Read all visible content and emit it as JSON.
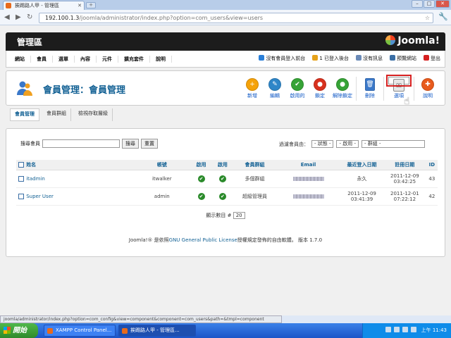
{
  "browser": {
    "tab_title": "挨踢路人甲 - 管理區",
    "new_tab": "+",
    "url_host": "192.100.1.3",
    "url_path": "/joomla/administrator/index.php?option=com_users&view=users",
    "status_url": "joomla/administrator/index.php?option=com_config&view=component&component=com_users&path=&tmpl=component"
  },
  "header": {
    "title": "管理區",
    "logo": "Joomla!"
  },
  "menu": [
    "網站",
    "會員",
    "選單",
    "內容",
    "元件",
    "擴充套件",
    "說明"
  ],
  "status": [
    {
      "label": "沒有會員登入前台",
      "color": "#2a7fd8"
    },
    {
      "label": "1 已登入後台",
      "color": "#e6a21a"
    },
    {
      "label": "沒有訊息",
      "color": "#6b8bb8"
    },
    {
      "label": "預覽網站",
      "color": "#3a6ea5"
    },
    {
      "label": "登出",
      "color": "#d62020"
    }
  ],
  "panel": {
    "title": "會員管理：會員管理"
  },
  "toolbar": [
    {
      "label": "新增",
      "color": "#f5a20a",
      "glyph": "+"
    },
    {
      "label": "編輯",
      "color": "#2e86c8",
      "glyph": "✎"
    },
    {
      "label": "啟用的",
      "color": "#36a336",
      "glyph": "✔"
    },
    {
      "label": "鎖定",
      "color": "#d8311e",
      "glyph": "●"
    },
    {
      "label": "解除鎖定",
      "color": "#36a336",
      "glyph": "●"
    },
    {
      "label": "刪除",
      "color": "#3a78c9",
      "glyph": "🗑"
    },
    {
      "label": "選項",
      "color": "#888888",
      "glyph": "⚙"
    },
    {
      "label": "說明",
      "color": "#e85a1c",
      "glyph": "✚"
    }
  ],
  "subtabs": [
    "會員管理",
    "會員群組",
    "檢視存取層級"
  ],
  "filter": {
    "search_label": "搜尋會員",
    "search_btn": "搜尋",
    "reset_btn": "重置",
    "filter_label": "過濾會員由：",
    "state": "- 狀態 -",
    "active": "- 啟用 -",
    "group": "- 群組 -"
  },
  "table": {
    "headers": [
      "姓名",
      "帳號",
      "啟用",
      "啟用",
      "會員群組",
      "Email",
      "最近登入日期",
      "註冊日期",
      "ID"
    ],
    "rows": [
      {
        "name": "itadmin",
        "username": "itwalker",
        "group": "多個群組",
        "last": "永久",
        "reg": "2011-12-09 03:42:25",
        "id": "43"
      },
      {
        "name": "Super User",
        "username": "admin",
        "group": "超級管理員",
        "last": "2011-12-09 03:41:39",
        "reg": "2011-12-01 07:22:12",
        "id": "42"
      }
    ],
    "display_label": "顯示數目 #",
    "display_value": "20"
  },
  "footer": {
    "pre": "Joomla!® 是依照",
    "link": "GNU General Public License",
    "post": "授權規定發佈的自由軟體。 版本 1.7.0"
  },
  "taskbar": {
    "start": "開始",
    "tasks": [
      "XAMPP Control Panel...",
      "挨踢路人甲 - 管理區..."
    ],
    "clock": "上午 11:43"
  }
}
